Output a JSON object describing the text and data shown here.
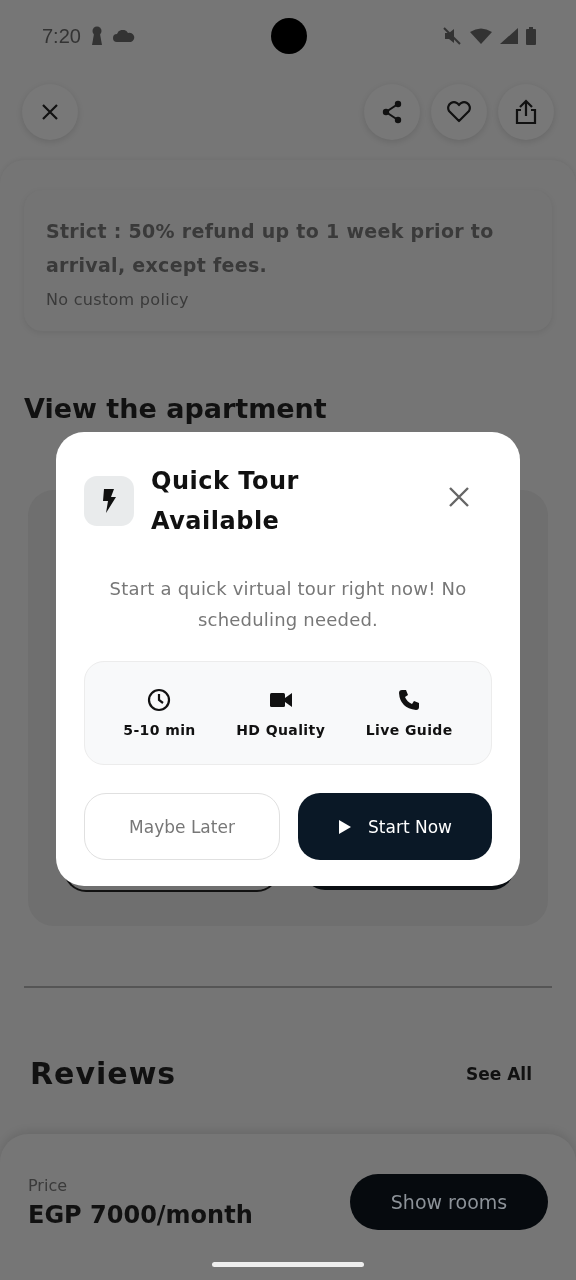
{
  "status_bar": {
    "time": "7:20"
  },
  "policy": {
    "title": "Strict : 50% refund up to 1 week prior to arrival, except fees.",
    "note": "No custom policy"
  },
  "section_title": "View the apartment",
  "reviews": {
    "title": "Reviews",
    "link": "See All"
  },
  "price_bar": {
    "label": "Price",
    "amount": "EGP 7000/month",
    "button": "Show rooms"
  },
  "dialog": {
    "title": "Quick Tour Available",
    "message": "Start a quick virtual tour right now! No scheduling needed.",
    "features": [
      {
        "kind": "duration",
        "label": "5-10 min"
      },
      {
        "kind": "video",
        "label": "HD Quality"
      },
      {
        "kind": "call",
        "label": "Live Guide"
      }
    ],
    "buttons": [
      {
        "kind": "secondary",
        "label": "Maybe Later"
      },
      {
        "kind": "primary",
        "label": "Start Now"
      }
    ]
  }
}
